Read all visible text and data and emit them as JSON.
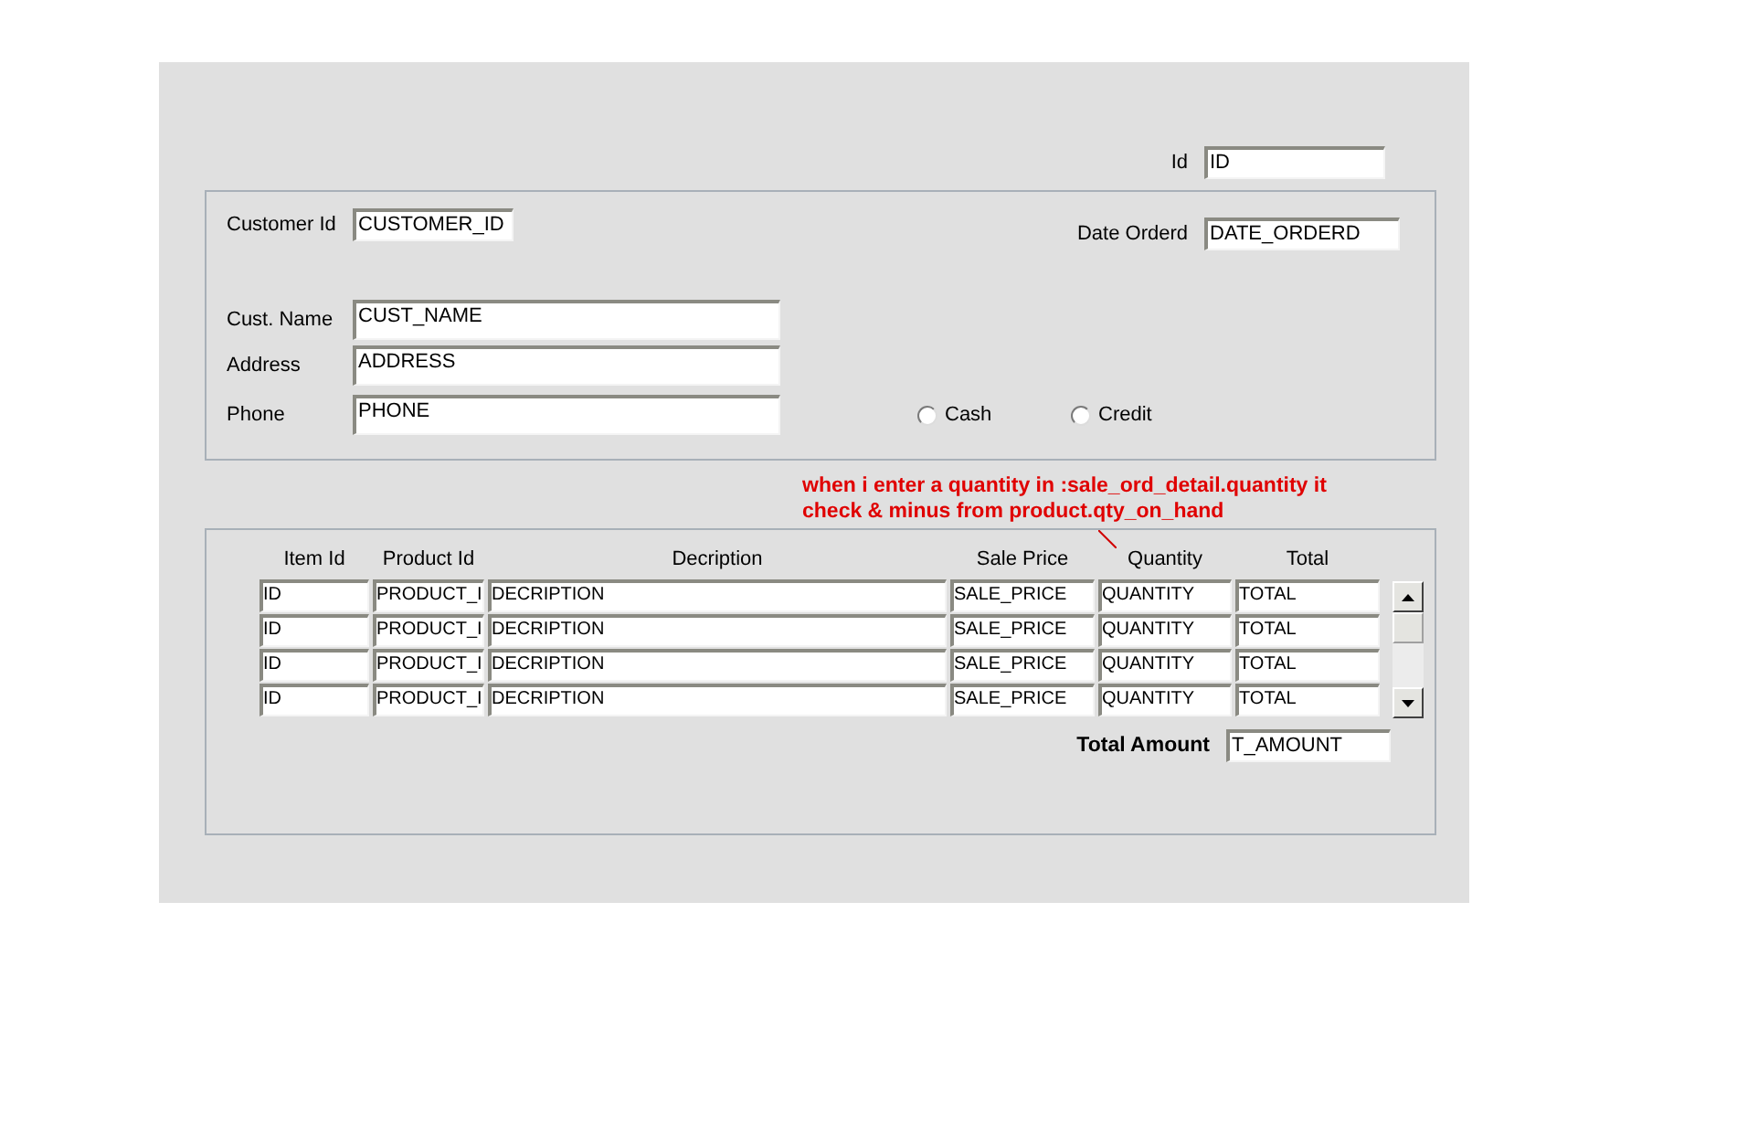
{
  "order_id": {
    "label": "Id",
    "value": "ID"
  },
  "customer": {
    "customer_id": {
      "label": "Customer Id",
      "value": "CUSTOMER_ID"
    },
    "date": {
      "label": "Date Orderd",
      "value": "DATE_ORDERD"
    },
    "fields": [
      {
        "label": "Cust. Name",
        "value": "CUST_NAME"
      },
      {
        "label": "Address",
        "value": "ADDRESS"
      },
      {
        "label": "Phone",
        "value": "PHONE"
      }
    ],
    "payment": [
      {
        "label": "Cash",
        "selected": false
      },
      {
        "label": "Credit",
        "selected": false
      }
    ]
  },
  "note": {
    "lines": [
      "when i enter a quantity in :sale_ord_detail.quantity it",
      "check & minus from product.qty_on_hand"
    ]
  },
  "detail": {
    "columns": [
      "Item Id",
      "Product Id",
      "Decription",
      "Sale Price",
      "Quantity",
      "Total"
    ],
    "rows": [
      [
        "ID",
        "PRODUCT_I",
        "DECRIPTION",
        "SALE_PRICE",
        "QUANTITY",
        "TOTAL"
      ],
      [
        "ID",
        "PRODUCT_I",
        "DECRIPTION",
        "SALE_PRICE",
        "QUANTITY",
        "TOTAL"
      ],
      [
        "ID",
        "PRODUCT_I",
        "DECRIPTION",
        "SALE_PRICE",
        "QUANTITY",
        "TOTAL"
      ],
      [
        "ID",
        "PRODUCT_I",
        "DECRIPTION",
        "SALE_PRICE",
        "QUANTITY",
        "TOTAL"
      ]
    ],
    "total": {
      "label": "Total Amount",
      "value": "T_AMOUNT"
    }
  }
}
